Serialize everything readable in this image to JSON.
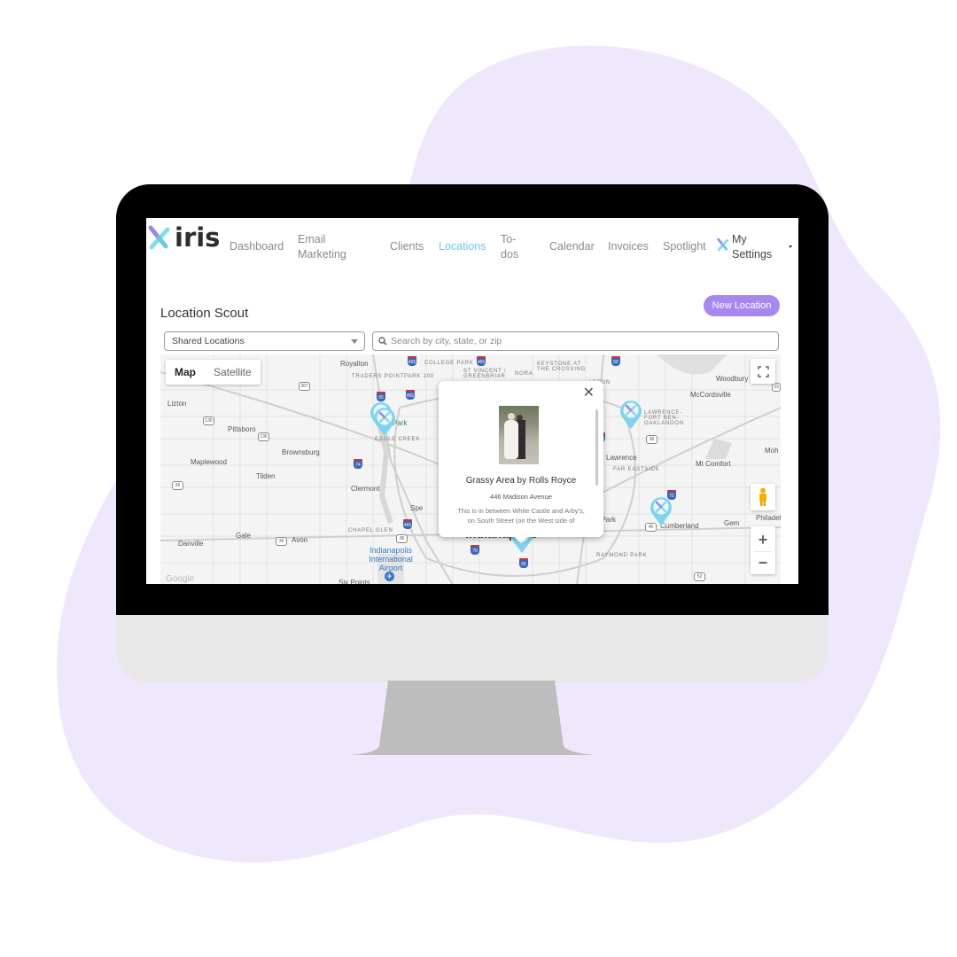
{
  "app": {
    "brand": "iris",
    "colors": {
      "accent": "#6ec6e6",
      "button": "#a788ee",
      "blob": "#efe8fc",
      "pin": "#7fd3ef"
    }
  },
  "nav": {
    "items": [
      {
        "label": "Dashboard"
      },
      {
        "label_line1": "Email",
        "label_line2": "Marketing"
      },
      {
        "label": "Clients"
      },
      {
        "label": "Locations",
        "active": true
      },
      {
        "label_line1": "To-",
        "label_line2": "dos"
      },
      {
        "label": "Calendar"
      },
      {
        "label": "Invoices"
      },
      {
        "label": "Spotlight"
      },
      {
        "label_line1": "My",
        "label_line2": "Settings"
      }
    ]
  },
  "page": {
    "title": "Location Scout",
    "new_button": "New Location",
    "filter_selected": "Shared Locations",
    "search_placeholder": "Search by city, state, or zip"
  },
  "map": {
    "type_toggle": {
      "map": "Map",
      "satellite": "Satellite",
      "selected": "Map"
    },
    "labels": {
      "royalton": "Royalton",
      "college_park": "COLLEGE PARK",
      "traders_point": "TRADERS POINT",
      "park100": "PARK 100",
      "st_vincent": "ST VINCENT / GREENBRIAR",
      "nora": "NORA",
      "keystone": "KEYSTONE AT THE CROSSING",
      "leton": "LETON",
      "woodbury": "Woodbury",
      "mccordsville": "McCordsville",
      "lawrence_fort": "LAWRENCE-FORT BEN-OAKLANDON",
      "lizton": "Lizton",
      "pittsboro": "Pittsboro",
      "brownsburg": "Brownsburg",
      "eagle_creek": "EAGLE CREEK",
      "crown_park": "Park",
      "maplewood": "Maplewood",
      "tilden": "Tilden",
      "clermont": "Clermont",
      "lawrence": "Lawrence",
      "far_eastside": "FAR EASTSIDE",
      "mt_comfort": "Mt Comfort",
      "mohawk": "Moh",
      "speedway": "Spe",
      "warren_park": "rren Park",
      "cumberland": "Cumberland",
      "gem": "Gem",
      "philadelphia": "Philadel",
      "danville": "Danville",
      "gale": "Gale",
      "avon": "Avon",
      "chapel_glen": "CHAPEL GLEN",
      "airport": "Indianapolis International Airport",
      "indianapolis": "Indianapolis",
      "raymond_park": "RAYMOND PARK",
      "six_points": "Six Points",
      "google": "Google"
    },
    "shields": {
      "i465a": "465",
      "i465b": "465",
      "i465c": "465",
      "i465d": "465",
      "i465e": "465",
      "i69": "69",
      "i65": "65",
      "i74": "74",
      "i70a": "70",
      "i70b": "70",
      "i65s": "65",
      "us136a": "136",
      "us136b": "136",
      "s267": "267",
      "s39": "39",
      "us36a": "36",
      "us36b": "36",
      "us36c": "36",
      "us40": "40",
      "us52": "52",
      "s238": "23"
    }
  },
  "popup": {
    "title": "Grassy Area by Rolls Royce",
    "address": "446 Madison Avenue",
    "description_line1": "This is in between White Castle and Arby's,",
    "description_line2": "on South Street (on the West side of"
  }
}
